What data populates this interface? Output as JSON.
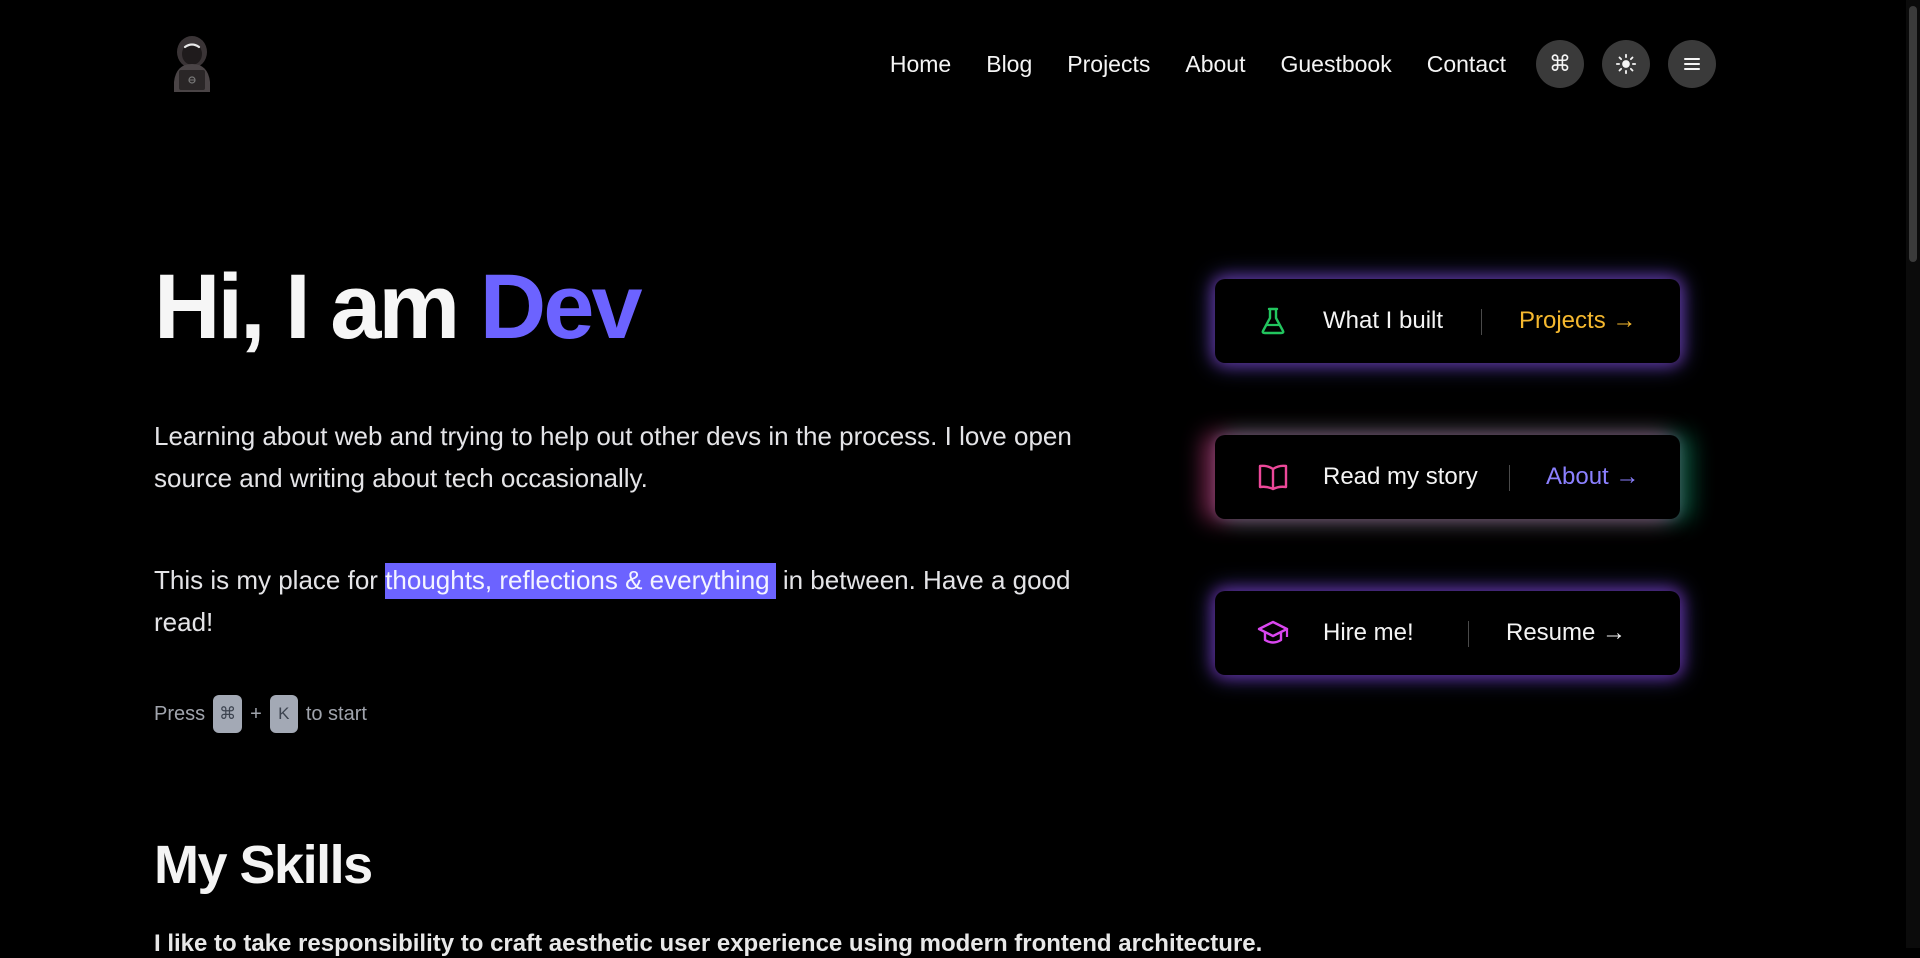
{
  "header": {
    "logo_alt": "hacker-avatar",
    "nav": [
      "Home",
      "Blog",
      "Projects",
      "About",
      "Guestbook",
      "Contact"
    ],
    "buttons": {
      "command": "⌘",
      "theme": "☀",
      "menu": "☰"
    }
  },
  "hero": {
    "title_prefix": "Hi, I am ",
    "title_accent": "Dev",
    "para1": "Learning about web and trying to help out other devs in the process. I love open source and writing about tech occasionally.",
    "para2_before": "This is my place for ",
    "para2_highlight": "thoughts, reflections & everything",
    "para2_after": " in between. Have a good read!",
    "press_label": "Press",
    "key1": "⌘",
    "plus": "+",
    "key2": "K",
    "press_suffix": "to start"
  },
  "cards": [
    {
      "label": "What I built",
      "link": "Projects →",
      "icon": "flask-icon",
      "icon_color": "#22c55e",
      "link_color": "#f5b82e"
    },
    {
      "label": "Read my story",
      "link": "About →",
      "icon": "book-icon",
      "icon_color": "#ec4899",
      "link_color": "#8b80ff"
    },
    {
      "label": "Hire me!",
      "link": "Resume →",
      "icon": "graduation-cap-icon",
      "icon_color": "#d946ef",
      "link_color": "#f4f4f4"
    }
  ],
  "skills": {
    "title": "My Skills",
    "text": "I like to take responsibility to craft aesthetic user experience using modern frontend architecture."
  },
  "colors": {
    "accent": "#6c63ff",
    "background": "#000000"
  }
}
